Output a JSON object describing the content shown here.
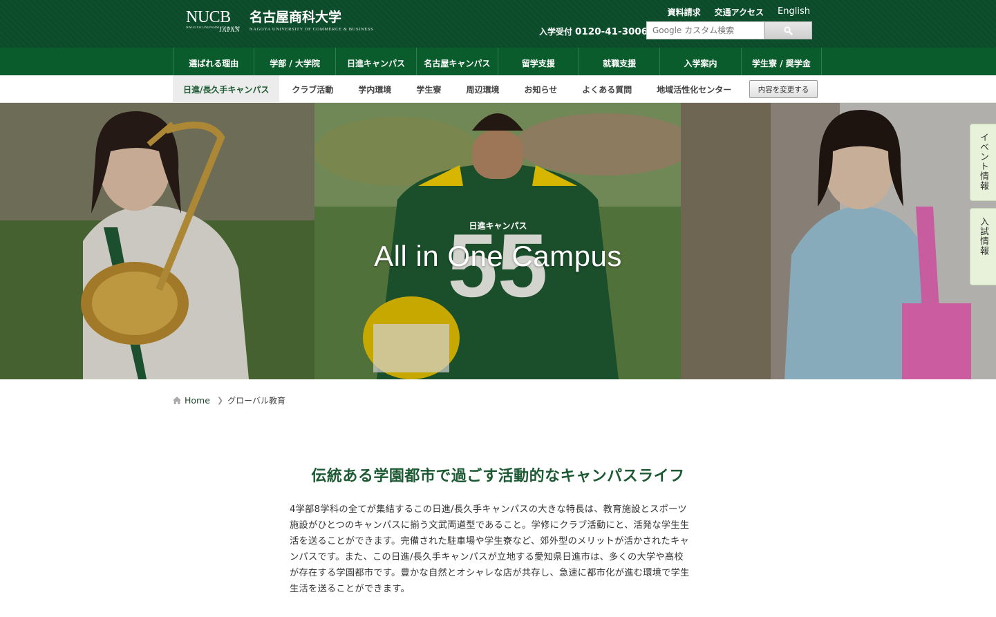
{
  "header": {
    "logo_mark": "NUCB",
    "logo_mark_sub": "NAGOYA UNIVERSITY OF COMMERCE & BUSINESS",
    "logo_japan": "JAPAN",
    "logo_name": "名古屋商科大学",
    "logo_en": "NAGOYA UNIVERSITY OF COMMERCE & BUSINESS",
    "util_links": [
      "資料請求",
      "交通アクセス",
      "English"
    ],
    "tel_label": "入学受付",
    "tel_number": "0120-41-3006",
    "search_placeholder": "Google カスタム検索"
  },
  "main_nav": [
    "選ばれる理由",
    "学部 / 大学院",
    "日進キャンパス",
    "名古屋キャンパス",
    "留学支援",
    "就職支援",
    "入学案内",
    "学生寮 / 奨学金"
  ],
  "sub_nav": {
    "items": [
      "日進/長久手キャンパス",
      "クラブ活動",
      "学内環境",
      "学生寮",
      "周辺環境",
      "お知らせ",
      "よくある質問",
      "地域活性化センター"
    ],
    "change_button": "内容を変更する"
  },
  "hero": {
    "subtitle": "日進キャンパス",
    "title": "All in One Campus"
  },
  "side_tabs": [
    "イベント情報",
    "入試情報"
  ],
  "breadcrumb": {
    "home": "Home",
    "current": "グローバル教育"
  },
  "content": {
    "heading": "伝統ある学園都市で過ごす活動的なキャンパスライフ",
    "lines": [
      "4学部8学科の全てが集結するこの日進/長久手キャンパスの大きな特長は、教育施設とスポーツ",
      "施設がひとつのキャンパスに揃う文武両道型であること。学修にクラブ活動にと、活発な学生生",
      "活を送ることができます。完備された駐車場や学生寮など、郊外型のメリットが活かされたキャ",
      "ンパスです。また、この日進/長久手キャンパスが立地する愛知県日進市は、多くの大学や高校",
      "が存在する学園都市です。豊かな自然とオシャレな店が共存し、急速に都市化が進む環境で学生",
      "生活を送ることができます。"
    ]
  }
}
